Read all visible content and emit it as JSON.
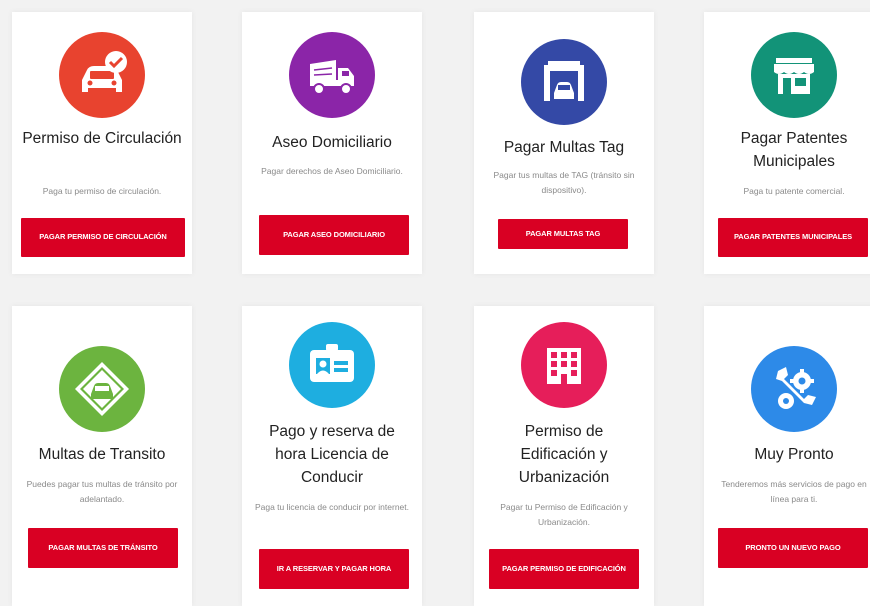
{
  "colors": {
    "button_red": "#d90023",
    "icon_red": "#e8432f",
    "icon_purple": "#8b25a8",
    "icon_blue": "#3449a6",
    "icon_teal": "#129378",
    "icon_green": "#6cb43f",
    "icon_cyan": "#1eaee0",
    "icon_pink": "#e61e5a",
    "icon_lightblue": "#2d8ae8"
  },
  "cards": [
    {
      "icon": "car-check-icon",
      "title": "Permiso de Circulación",
      "description": "Paga tu permiso de circulación.",
      "button": "PAGAR PERMISO DE CIRCULACIÓN"
    },
    {
      "icon": "garbage-truck-icon",
      "title": "Aseo Domiciliario",
      "description": "Pagar derechos de Aseo Domiciliario.",
      "button": "PAGAR ASEO DOMICILIARIO"
    },
    {
      "icon": "toll-gate-icon",
      "title": "Pagar Multas Tag",
      "description": "Pagar tus multas de TAG (tránsito sin dispositivo).",
      "button": "PAGAR MULTAS TAG"
    },
    {
      "icon": "storefront-icon",
      "title": "Pagar Patentes Municipales",
      "description": "Paga tu patente comercial.",
      "button": "PAGAR PATENTES MUNICIPALES"
    },
    {
      "icon": "traffic-sign-car-icon",
      "title": "Multas de Transito",
      "description": "Puedes pagar tus multas de tránsito por adelantado.",
      "button": "PAGAR MULTAS DE TRÁNSITO"
    },
    {
      "icon": "id-card-icon",
      "title": "Pago y reserva de hora  Licencia de Conducir",
      "description": "Paga tu licencia de conducir por internet.",
      "button": "IR A RESERVAR Y PAGAR HORA"
    },
    {
      "icon": "building-icon",
      "title": "Permiso de Edificación y Urbanización",
      "description": "Pagar tu Permiso de Edificación y Urbanización.",
      "button": "PAGAR PERMISO DE EDIFICACIÓN"
    },
    {
      "icon": "wrench-gear-icon",
      "title": "Muy Pronto",
      "description": "Tenderemos más servicios de pago en línea para ti.",
      "button": "PRONTO UN NUEVO PAGO"
    }
  ]
}
